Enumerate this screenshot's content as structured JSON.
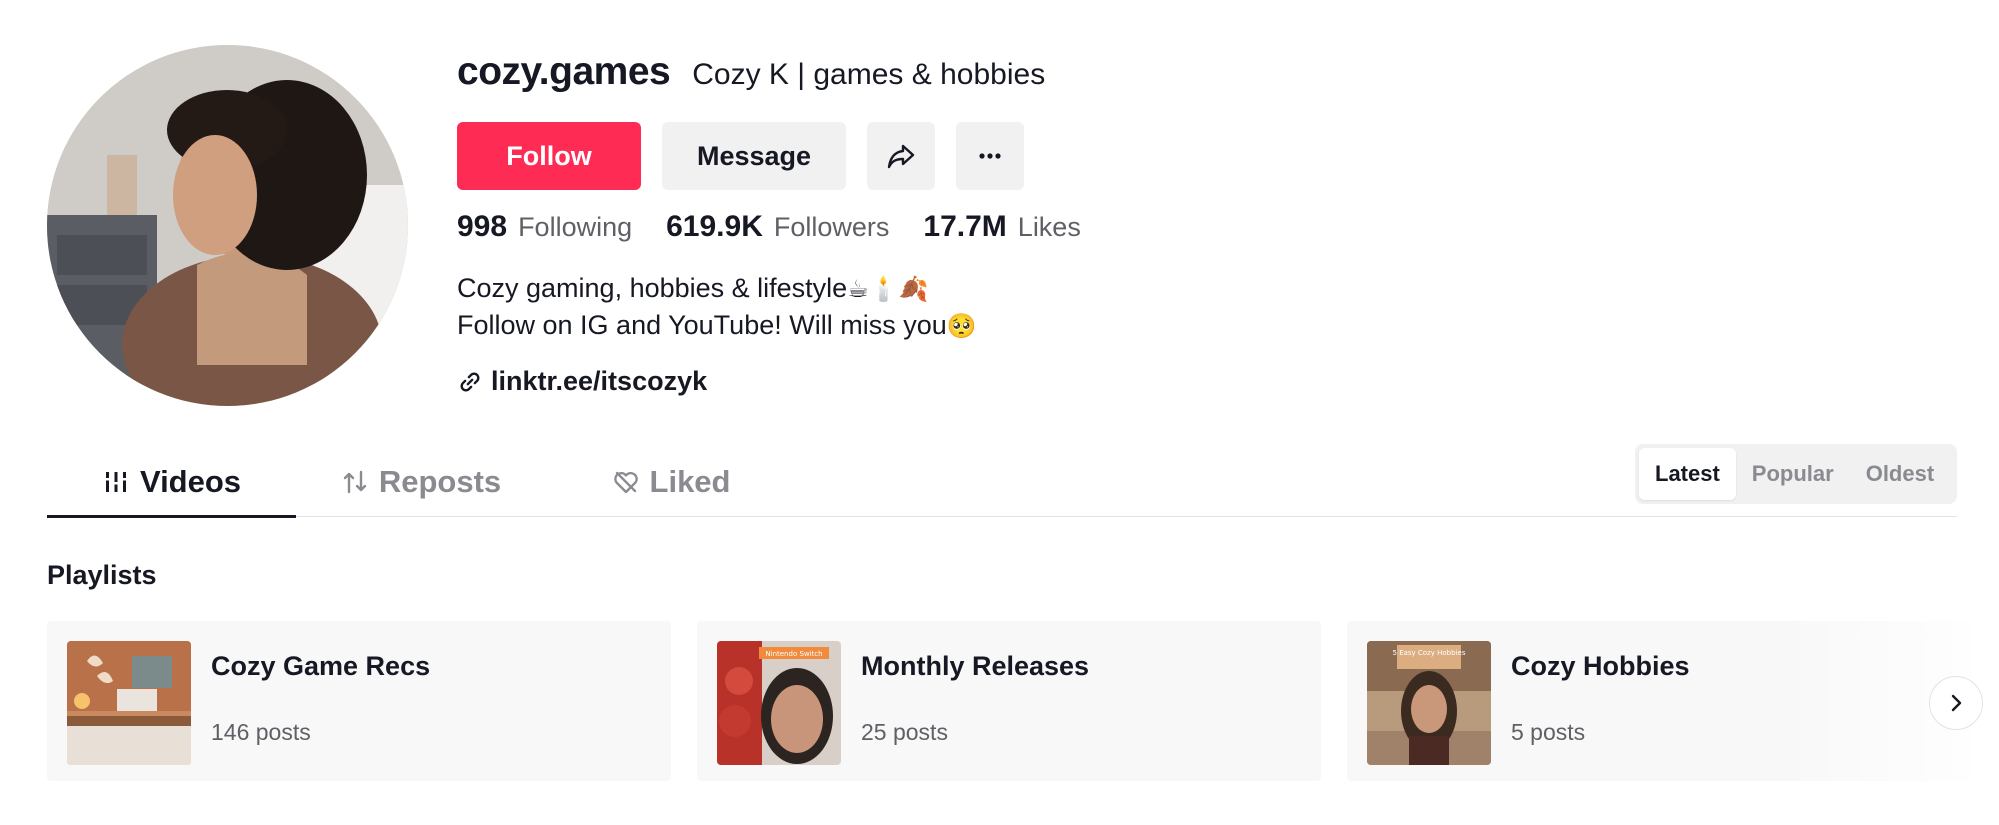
{
  "profile": {
    "username": "cozy.games",
    "nickname": "Cozy K | games & hobbies"
  },
  "actions": {
    "follow_label": "Follow",
    "message_label": "Message"
  },
  "stats": [
    {
      "value": "998",
      "label": "Following"
    },
    {
      "value": "619.9K",
      "label": "Followers"
    },
    {
      "value": "17.7M",
      "label": "Likes"
    }
  ],
  "bio": {
    "line1": "Cozy gaming, hobbies & lifestyle",
    "line1_emoji": "☕🕯️🍂",
    "line2": "Follow on IG and YouTube! Will miss you",
    "line2_emoji": "🥺"
  },
  "link": "linktr.ee/itscozyk",
  "tabs": [
    {
      "label": "Videos",
      "active": true
    },
    {
      "label": "Reposts",
      "active": false
    },
    {
      "label": "Liked",
      "active": false
    }
  ],
  "sort": [
    "Latest",
    "Popular",
    "Oldest"
  ],
  "playlists_title": "Playlists",
  "playlists": [
    {
      "name": "Cozy Game Recs",
      "count": "146 posts"
    },
    {
      "name": "Monthly Releases",
      "count": "25 posts",
      "thumb_text": "Nintendo Switch"
    },
    {
      "name": "Cozy Hobbies",
      "count": "5 posts",
      "thumb_text": "5 Easy Cozy Hobbies"
    }
  ],
  "colors": {
    "accent": "#fe2c55",
    "text": "#161823",
    "muted": "#8a8b91"
  }
}
